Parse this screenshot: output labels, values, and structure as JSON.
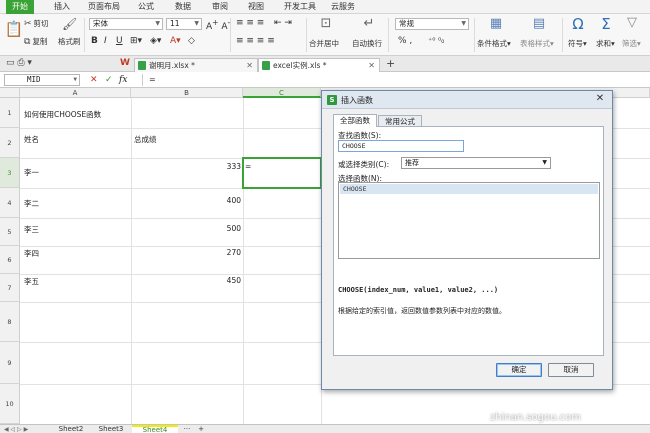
{
  "menu": {
    "tabs": [
      "开始",
      "插入",
      "页面布局",
      "公式",
      "数据",
      "审阅",
      "视图",
      "开发工具",
      "云服务"
    ]
  },
  "ribbon": {
    "cut": "剪切",
    "copy": "复制",
    "format_painter": "格式刷",
    "font_name": "宋体",
    "font_size": "11",
    "merge_center": "合并居中",
    "wrap_text": "自动换行",
    "number_format": "常规",
    "percent": "% ,",
    "conditional_format": "条件格式",
    "table_style": "表格样式",
    "symbol": "符号",
    "sum": "求和",
    "filter": "筛选"
  },
  "doc_tabs": [
    {
      "title": "谢明月.xlsx *",
      "active": false
    },
    {
      "title": "excel实例.xls *",
      "active": true
    }
  ],
  "formula_bar": {
    "name_box": "MID",
    "cancel": "✕",
    "confirm": "✓",
    "fx": "fx",
    "value": "="
  },
  "grid": {
    "columns": [
      "A",
      "B",
      "C"
    ],
    "rows": [
      "1",
      "2",
      "3",
      "4",
      "5",
      "6",
      "7",
      "8",
      "9",
      "10"
    ],
    "cells": {
      "a1": "如何使用CHOOSE函数",
      "a2": "姓名",
      "b2": "总成绩",
      "a3": "李一",
      "b3": "333",
      "c3": "=",
      "a4": "李二",
      "b4": "400",
      "a5": "李三",
      "b5": "500",
      "a6": "李四",
      "b6": "270",
      "a7": "李五",
      "b7": "450"
    }
  },
  "sheets": {
    "tabs": [
      "Sheet2",
      "Sheet3",
      "Sheet4"
    ],
    "more": "···",
    "add": "+"
  },
  "dialog": {
    "title": "插入函数",
    "logo": "S",
    "close": "✕",
    "tabs": [
      "全部函数",
      "常用公式"
    ],
    "search_label": "查找函数(S):",
    "search_value": "CHOOSE",
    "category_label": "或选择类别(C):",
    "category_value": "推荐",
    "list_label": "选择函数(N):",
    "list_items": [
      "CHOOSE"
    ],
    "signature": "CHOOSE(index_num, value1, value2, ...)",
    "description": "根据给定的索引值，返回数值参数列表中对应的数值。",
    "ok": "确定",
    "cancel": "取消"
  },
  "watermark": "zhinan.sogou.com"
}
